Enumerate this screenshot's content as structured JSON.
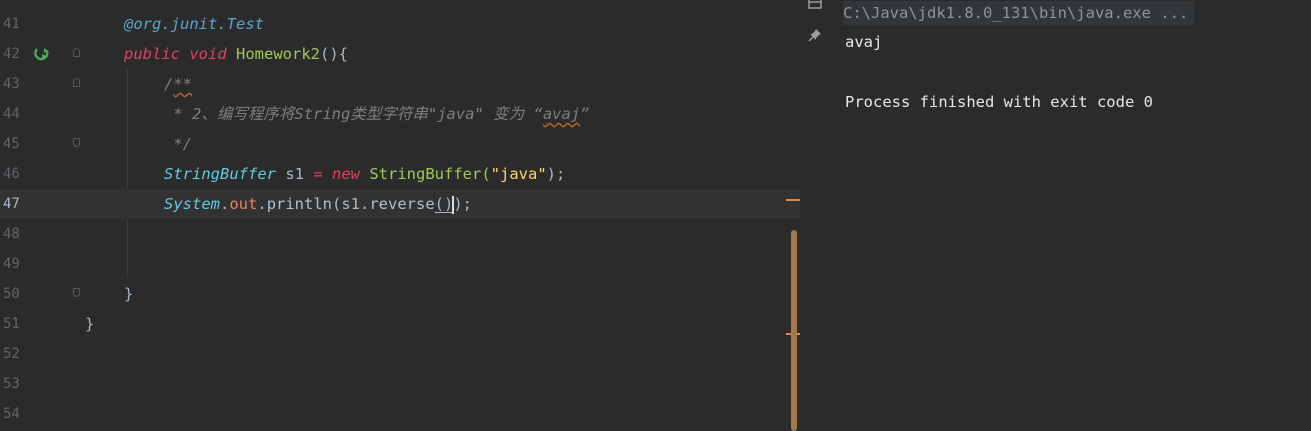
{
  "editor": {
    "lines": [
      {
        "n": "41"
      },
      {
        "n": "42"
      },
      {
        "n": "43"
      },
      {
        "n": "44"
      },
      {
        "n": "45"
      },
      {
        "n": "46"
      },
      {
        "n": "47"
      },
      {
        "n": "48"
      },
      {
        "n": "49"
      },
      {
        "n": "50"
      },
      {
        "n": "51"
      },
      {
        "n": "52"
      },
      {
        "n": "53"
      },
      {
        "n": "54"
      }
    ],
    "code": {
      "l41_anno": "@org.junit.Test",
      "l42_public": "public",
      "l42_void": "void",
      "l42_name": "Homework2",
      "l42_rest": "(){",
      "l43_open": "/",
      "l43_stars": "**",
      "l44_text": " * 2、编写程序将String类型字符串\"java\" 变为 “",
      "l44_word": "avaj",
      "l44_end": "”",
      "l45_text": " */",
      "l46_type": "StringBuffer",
      "l46_var": " s1 ",
      "l46_eq": "=",
      "l46_new": "new",
      "l46_ctor": " StringBuffer(",
      "l46_str": "\"java\"",
      "l46_end": ");",
      "l47_sys": "System",
      "l47_dot1": ".",
      "l47_out": "out",
      "l47_dot2": ".",
      "l47_println": "println",
      "l47_args": "(s1.",
      "l47_rev": "reverse",
      "l47_parens": "()",
      "l47_end": ");",
      "l50_brace": "}",
      "l51_brace": "}"
    }
  },
  "console": {
    "command": "C:\\Java\\jdk1.8.0_131\\bin\\java.exe ...",
    "output": "avaj",
    "exit_message": "Process finished with exit code 0"
  },
  "icons": {
    "run": "run-test-icon",
    "layout": "layout-icon",
    "pin": "pin-icon"
  },
  "colors": {
    "background": "#2b2b2b",
    "keyword": "#e5405e",
    "string": "#ffd866",
    "type": "#5fcce0",
    "method": "#9fca56",
    "marker": "#e0883c"
  }
}
